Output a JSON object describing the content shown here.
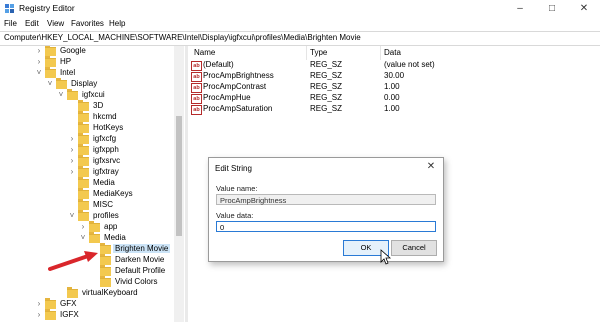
{
  "window": {
    "title": "Registry Editor"
  },
  "menu": [
    "File",
    "Edit",
    "View",
    "Favorites",
    "Help"
  ],
  "address": "Computer\\HKEY_LOCAL_MACHINE\\SOFTWARE\\Intel\\Display\\igfxcui\\profiles\\Media\\Brighten Movie",
  "tree": [
    {
      "label": "Google",
      "indent": 0,
      "chevron": ">"
    },
    {
      "label": "HP",
      "indent": 0,
      "chevron": ">"
    },
    {
      "label": "Intel",
      "indent": 0,
      "chevron": "v"
    },
    {
      "label": "Display",
      "indent": 1,
      "chevron": "v"
    },
    {
      "label": "igfxcui",
      "indent": 2,
      "chevron": "v"
    },
    {
      "label": "3D",
      "indent": 3,
      "chevron": ""
    },
    {
      "label": "hkcmd",
      "indent": 3,
      "chevron": ""
    },
    {
      "label": "HotKeys",
      "indent": 3,
      "chevron": ""
    },
    {
      "label": "igfxcfg",
      "indent": 3,
      "chevron": ">"
    },
    {
      "label": "igfxpph",
      "indent": 3,
      "chevron": ">"
    },
    {
      "label": "igfxsrvc",
      "indent": 3,
      "chevron": ">"
    },
    {
      "label": "igfxtray",
      "indent": 3,
      "chevron": ">"
    },
    {
      "label": "Media",
      "indent": 3,
      "chevron": ""
    },
    {
      "label": "MediaKeys",
      "indent": 3,
      "chevron": ""
    },
    {
      "label": "MISC",
      "indent": 3,
      "chevron": ""
    },
    {
      "label": "profiles",
      "indent": 3,
      "chevron": "v"
    },
    {
      "label": "app",
      "indent": 4,
      "chevron": ">"
    },
    {
      "label": "Media",
      "indent": 4,
      "chevron": "v"
    },
    {
      "label": "Brighten Movie",
      "indent": 5,
      "chevron": "",
      "selected": true
    },
    {
      "label": "Darken Movie",
      "indent": 5,
      "chevron": ""
    },
    {
      "label": "Default Profile",
      "indent": 5,
      "chevron": ""
    },
    {
      "label": "Vivid Colors",
      "indent": 5,
      "chevron": ""
    },
    {
      "label": "virtualKeyboard",
      "indent": 2,
      "chevron": ""
    },
    {
      "label": "GFX",
      "indent": 0,
      "chevron": ">"
    },
    {
      "label": "IGFX",
      "indent": 0,
      "chevron": ">"
    }
  ],
  "columns": {
    "name": "Name",
    "type": "Type",
    "data": "Data"
  },
  "values": [
    {
      "name": "(Default)",
      "type": "REG_SZ",
      "data": "(value not set)"
    },
    {
      "name": "ProcAmpBrightness",
      "type": "REG_SZ",
      "data": "30.00"
    },
    {
      "name": "ProcAmpContrast",
      "type": "REG_SZ",
      "data": "1.00"
    },
    {
      "name": "ProcAmpHue",
      "type": "REG_SZ",
      "data": "0.00"
    },
    {
      "name": "ProcAmpSaturation",
      "type": "REG_SZ",
      "data": "1.00"
    }
  ],
  "dialog": {
    "title": "Edit String",
    "value_name_label": "Value name:",
    "value_name": "ProcAmpBrightness",
    "value_data_label": "Value data:",
    "value_data": "0",
    "ok": "OK",
    "cancel": "Cancel"
  },
  "colors": {
    "folder": "#f3c94f",
    "selection": "#cce4f7",
    "accent": "#2a7ad5",
    "arrow": "#d9262b"
  }
}
